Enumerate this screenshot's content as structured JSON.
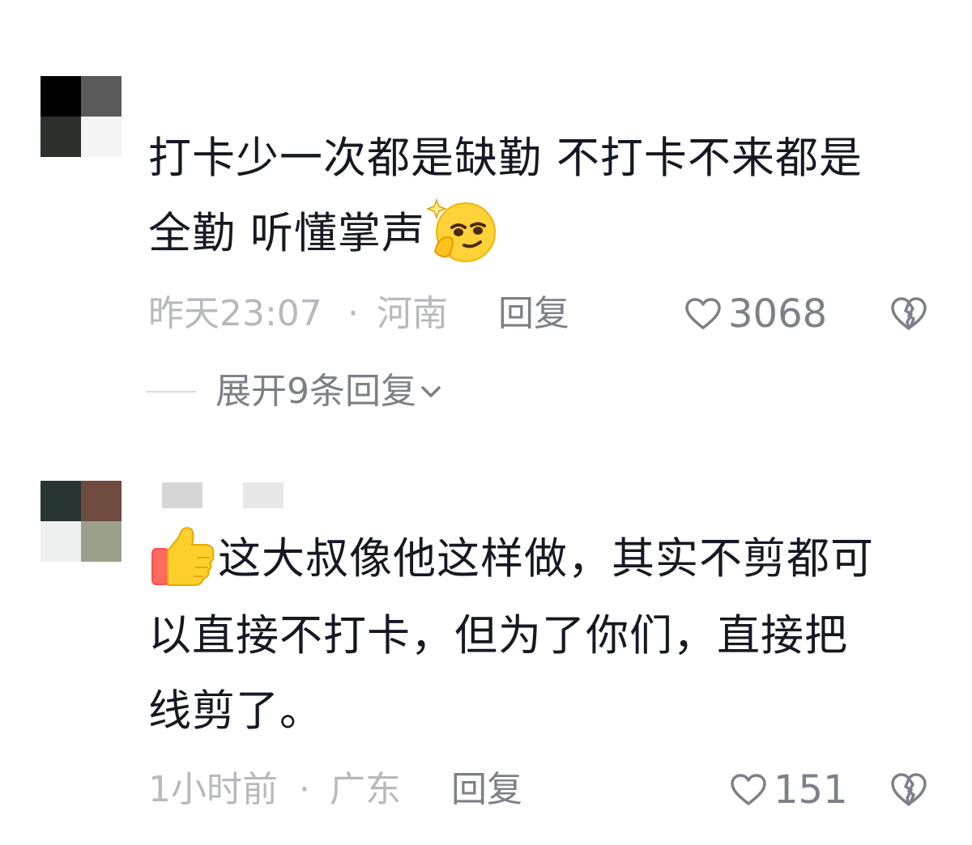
{
  "comments": [
    {
      "text_line1": "打卡少一次都是缺勤 不打卡不来都是",
      "text_line2": "全勤 听懂掌声",
      "emoji": "thinking-smirk-emoji",
      "time": "昨天23:07",
      "separator": "·",
      "region": "河南",
      "reply_label": "回复",
      "like_count": "3068",
      "expand_label": "展开9条回复"
    },
    {
      "emoji": "thumbs-up-emoji",
      "text_line1": "这大叔像他这样做，其实不剪都可",
      "text_line2": "以直接不打卡，但为了你们，直接把",
      "text_line3": "线剪了。",
      "time": "1小时前",
      "separator": "·",
      "region": "广东",
      "reply_label": "回复",
      "like_count": "151"
    }
  ],
  "colors": {
    "text": "#161823",
    "meta_light": "#b7b9bf",
    "meta_dark": "#7e8089",
    "divider": "#d8d9dc"
  },
  "icons": [
    "heart-outline-icon",
    "dislike-broken-heart-icon",
    "chevron-down-icon"
  ]
}
